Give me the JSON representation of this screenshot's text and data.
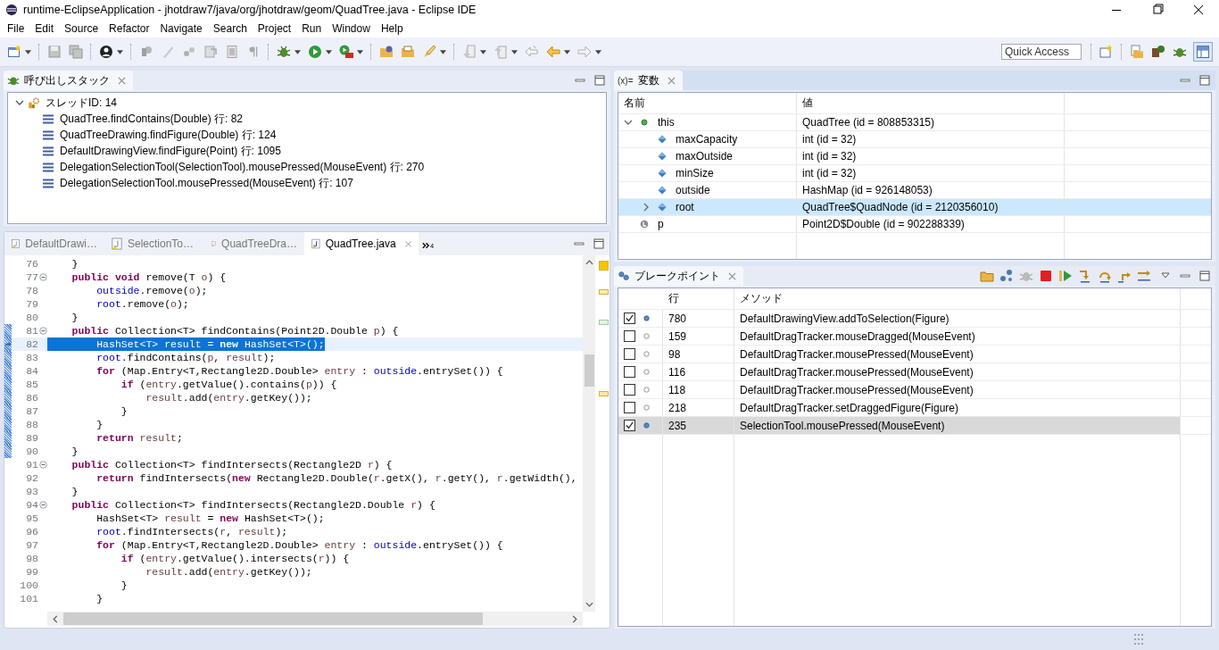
{
  "window": {
    "title": "runtime-EclipseApplication - jhotdraw7/java/org/jhotdraw/geom/QuadTree.java - Eclipse IDE"
  },
  "menu": [
    "File",
    "Edit",
    "Source",
    "Refactor",
    "Navigate",
    "Search",
    "Project",
    "Run",
    "Window",
    "Help"
  ],
  "quick_access": {
    "placeholder": "Quick Access"
  },
  "call_stack": {
    "title": "呼び出しスタック",
    "threads": [
      {
        "label": "スレッドID: 14",
        "expanded": true,
        "children": [
          {
            "label": "QuadTree.findContains(Double) 行: 82"
          },
          {
            "label": "QuadTreeDrawing.findFigure(Double) 行: 124"
          },
          {
            "label": "DefaultDrawingView.findFigure(Point) 行: 1095"
          },
          {
            "label": "DelegationSelectionTool(SelectionTool).mousePressed(MouseEvent) 行: 270"
          },
          {
            "label": "DelegationSelectionTool.mousePressed(MouseEvent) 行: 107"
          }
        ]
      }
    ]
  },
  "editor": {
    "tabs": [
      {
        "label": "DefaultDrawi…",
        "selected": false
      },
      {
        "label": "SelectionTo…",
        "selected": false
      },
      {
        "label": "QuadTreeDra…",
        "selected": false
      },
      {
        "label": "QuadTree.java",
        "selected": true
      }
    ],
    "overflow_count": "4",
    "lines": [
      {
        "number": "76",
        "fold": false,
        "range": false,
        "current": false,
        "tokens": [
          {
            "kind": "text",
            "text": "    }"
          }
        ]
      },
      {
        "number": "77",
        "fold": true,
        "range": false,
        "current": false,
        "tokens": [
          {
            "kind": "kw",
            "text": "    public void"
          },
          {
            "kind": "text",
            "text": " remove(T "
          },
          {
            "kind": "var",
            "text": "o"
          },
          {
            "kind": "text",
            "text": ") {"
          }
        ]
      },
      {
        "number": "78",
        "fold": false,
        "range": false,
        "current": false,
        "tokens": [
          {
            "kind": "field",
            "text": "        outside"
          },
          {
            "kind": "text",
            "text": ".remove("
          },
          {
            "kind": "var",
            "text": "o"
          },
          {
            "kind": "text",
            "text": ");"
          }
        ]
      },
      {
        "number": "79",
        "fold": false,
        "range": false,
        "current": false,
        "tokens": [
          {
            "kind": "field",
            "text": "        root"
          },
          {
            "kind": "text",
            "text": ".remove("
          },
          {
            "kind": "var",
            "text": "o"
          },
          {
            "kind": "text",
            "text": ");"
          }
        ]
      },
      {
        "number": "80",
        "fold": false,
        "range": false,
        "current": false,
        "tokens": [
          {
            "kind": "text",
            "text": "    }"
          }
        ]
      },
      {
        "number": "81",
        "fold": true,
        "range": true,
        "current": false,
        "tokens": [
          {
            "kind": "kw",
            "text": "    public"
          },
          {
            "kind": "text",
            "text": " Collection<T> findContains(Point2D.Double "
          },
          {
            "kind": "var",
            "text": "p"
          },
          {
            "kind": "text",
            "text": ") {"
          }
        ]
      },
      {
        "number": "82",
        "fold": false,
        "range": true,
        "current": true,
        "tokens": [
          {
            "kind": "text",
            "text": "        HashSet<T> "
          },
          {
            "kind": "var",
            "text": "result"
          },
          {
            "kind": "text",
            "text": " = "
          },
          {
            "kind": "kw",
            "text": "new"
          },
          {
            "kind": "text",
            "text": " HashSet<T>();"
          }
        ]
      },
      {
        "number": "83",
        "fold": false,
        "range": true,
        "current": false,
        "tokens": [
          {
            "kind": "field",
            "text": "        root"
          },
          {
            "kind": "text",
            "text": ".findContains("
          },
          {
            "kind": "var",
            "text": "p"
          },
          {
            "kind": "text",
            "text": ", "
          },
          {
            "kind": "var",
            "text": "result"
          },
          {
            "kind": "text",
            "text": ");"
          }
        ]
      },
      {
        "number": "84",
        "fold": false,
        "range": true,
        "current": false,
        "tokens": [
          {
            "kind": "kw",
            "text": "        for"
          },
          {
            "kind": "text",
            "text": " (Map.Entry<T,Rectangle2D.Double> "
          },
          {
            "kind": "var",
            "text": "entry"
          },
          {
            "kind": "text",
            "text": " : "
          },
          {
            "kind": "field",
            "text": "outside"
          },
          {
            "kind": "text",
            "text": ".entrySet()) {"
          }
        ]
      },
      {
        "number": "85",
        "fold": false,
        "range": true,
        "current": false,
        "tokens": [
          {
            "kind": "kw",
            "text": "            if"
          },
          {
            "kind": "text",
            "text": " ("
          },
          {
            "kind": "var",
            "text": "entry"
          },
          {
            "kind": "text",
            "text": ".getValue().contains("
          },
          {
            "kind": "var",
            "text": "p"
          },
          {
            "kind": "text",
            "text": ")) {"
          }
        ]
      },
      {
        "number": "86",
        "fold": false,
        "range": true,
        "current": false,
        "tokens": [
          {
            "kind": "var",
            "text": "                result"
          },
          {
            "kind": "text",
            "text": ".add("
          },
          {
            "kind": "var",
            "text": "entry"
          },
          {
            "kind": "text",
            "text": ".getKey());"
          }
        ]
      },
      {
        "number": "87",
        "fold": false,
        "range": true,
        "current": false,
        "tokens": [
          {
            "kind": "text",
            "text": "            }"
          }
        ]
      },
      {
        "number": "88",
        "fold": false,
        "range": true,
        "current": false,
        "tokens": [
          {
            "kind": "text",
            "text": "        }"
          }
        ]
      },
      {
        "number": "89",
        "fold": false,
        "range": true,
        "current": false,
        "tokens": [
          {
            "kind": "kw",
            "text": "        return "
          },
          {
            "kind": "var",
            "text": "result"
          },
          {
            "kind": "text",
            "text": ";"
          }
        ]
      },
      {
        "number": "90",
        "fold": false,
        "range": true,
        "current": false,
        "tokens": [
          {
            "kind": "text",
            "text": "    }"
          }
        ]
      },
      {
        "number": "91",
        "fold": true,
        "range": false,
        "current": false,
        "tokens": [
          {
            "kind": "kw",
            "text": "    public"
          },
          {
            "kind": "text",
            "text": " Collection<T> findIntersects(Rectangle2D "
          },
          {
            "kind": "var",
            "text": "r"
          },
          {
            "kind": "text",
            "text": ") {"
          }
        ]
      },
      {
        "number": "92",
        "fold": false,
        "range": false,
        "current": false,
        "tokens": [
          {
            "kind": "kw",
            "text": "        return"
          },
          {
            "kind": "text",
            "text": " findIntersects("
          },
          {
            "kind": "kw",
            "text": "new"
          },
          {
            "kind": "text",
            "text": " Rectangle2D.Double("
          },
          {
            "kind": "var",
            "text": "r"
          },
          {
            "kind": "text",
            "text": ".getX(), "
          },
          {
            "kind": "var",
            "text": "r"
          },
          {
            "kind": "text",
            "text": ".getY(), "
          },
          {
            "kind": "var",
            "text": "r"
          },
          {
            "kind": "text",
            "text": ".getWidth(),"
          }
        ]
      },
      {
        "number": "93",
        "fold": false,
        "range": false,
        "current": false,
        "tokens": [
          {
            "kind": "text",
            "text": "    }"
          }
        ]
      },
      {
        "number": "94",
        "fold": true,
        "range": false,
        "current": false,
        "tokens": [
          {
            "kind": "kw",
            "text": "    public"
          },
          {
            "kind": "text",
            "text": " Collection<T> findIntersects(Rectangle2D.Double "
          },
          {
            "kind": "var",
            "text": "r"
          },
          {
            "kind": "text",
            "text": ") {"
          }
        ]
      },
      {
        "number": "95",
        "fold": false,
        "range": false,
        "current": false,
        "tokens": [
          {
            "kind": "text",
            "text": "        HashSet<T> "
          },
          {
            "kind": "var",
            "text": "result"
          },
          {
            "kind": "text",
            "text": " = "
          },
          {
            "kind": "kw",
            "text": "new"
          },
          {
            "kind": "text",
            "text": " HashSet<T>();"
          }
        ]
      },
      {
        "number": "96",
        "fold": false,
        "range": false,
        "current": false,
        "tokens": [
          {
            "kind": "field",
            "text": "        root"
          },
          {
            "kind": "text",
            "text": ".findIntersects("
          },
          {
            "kind": "var",
            "text": "r"
          },
          {
            "kind": "text",
            "text": ", "
          },
          {
            "kind": "var",
            "text": "result"
          },
          {
            "kind": "text",
            "text": ");"
          }
        ]
      },
      {
        "number": "97",
        "fold": false,
        "range": false,
        "current": false,
        "tokens": [
          {
            "kind": "kw",
            "text": "        for"
          },
          {
            "kind": "text",
            "text": " (Map.Entry<T,Rectangle2D.Double> "
          },
          {
            "kind": "var",
            "text": "entry"
          },
          {
            "kind": "text",
            "text": " : "
          },
          {
            "kind": "field",
            "text": "outside"
          },
          {
            "kind": "text",
            "text": ".entrySet()) {"
          }
        ]
      },
      {
        "number": "98",
        "fold": false,
        "range": false,
        "current": false,
        "tokens": [
          {
            "kind": "kw",
            "text": "            if"
          },
          {
            "kind": "text",
            "text": " ("
          },
          {
            "kind": "var",
            "text": "entry"
          },
          {
            "kind": "text",
            "text": ".getValue().intersects("
          },
          {
            "kind": "var",
            "text": "r"
          },
          {
            "kind": "text",
            "text": ")) {"
          }
        ]
      },
      {
        "number": "99",
        "fold": false,
        "range": false,
        "current": false,
        "tokens": [
          {
            "kind": "var",
            "text": "                result"
          },
          {
            "kind": "text",
            "text": ".add("
          },
          {
            "kind": "var",
            "text": "entry"
          },
          {
            "kind": "text",
            "text": ".getKey());"
          }
        ]
      },
      {
        "number": "100",
        "fold": false,
        "range": false,
        "current": false,
        "tokens": [
          {
            "kind": "text",
            "text": "            }"
          }
        ]
      },
      {
        "number": "101",
        "fold": false,
        "range": false,
        "current": false,
        "tokens": [
          {
            "kind": "text",
            "text": "        }"
          }
        ]
      }
    ]
  },
  "variables": {
    "icon_glyph": "(x)=",
    "title": "変数",
    "columns": [
      "名前",
      "値"
    ],
    "rows": [
      {
        "name": "this",
        "value": "QuadTree (id = 808853315)",
        "kind": "object",
        "expanded": true,
        "selected": false,
        "children": [
          {
            "name": "maxCapacity",
            "value": "int (id = 32)",
            "kind": "field",
            "selected": false
          },
          {
            "name": "maxOutside",
            "value": "int (id = 32)",
            "kind": "field",
            "selected": false
          },
          {
            "name": "minSize",
            "value": "int (id = 32)",
            "kind": "field",
            "selected": false
          },
          {
            "name": "outside",
            "value": "HashMap (id = 926148053)",
            "kind": "field",
            "selected": false
          },
          {
            "name": "root",
            "value": "QuadTree$QuadNode (id = 2120356010)",
            "kind": "field",
            "expanded": false,
            "selected": true
          }
        ]
      },
      {
        "name": "p",
        "value": "Point2D$Double (id = 902288339)",
        "kind": "local",
        "selected": false
      }
    ]
  },
  "breakpoints": {
    "title": "ブレークポイント",
    "columns": [
      "行",
      "メソッド"
    ],
    "rows": [
      {
        "checked": true,
        "line": "780",
        "method": "DefaultDrawingView.addToSelection(Figure)",
        "selected": false
      },
      {
        "checked": false,
        "line": "159",
        "method": "DefaultDragTracker.mouseDragged(MouseEvent)",
        "selected": false
      },
      {
        "checked": false,
        "line": "98",
        "method": "DefaultDragTracker.mousePressed(MouseEvent)",
        "selected": false
      },
      {
        "checked": false,
        "line": "116",
        "method": "DefaultDragTracker.mousePressed(MouseEvent)",
        "selected": false
      },
      {
        "checked": false,
        "line": "118",
        "method": "DefaultDragTracker.mousePressed(MouseEvent)",
        "selected": false
      },
      {
        "checked": false,
        "line": "218",
        "method": "DefaultDragTracker.setDraggedFigure(Figure)",
        "selected": false
      },
      {
        "checked": true,
        "line": "235",
        "method": "SelectionTool.mousePressed(MouseEvent)",
        "selected": true
      }
    ]
  }
}
